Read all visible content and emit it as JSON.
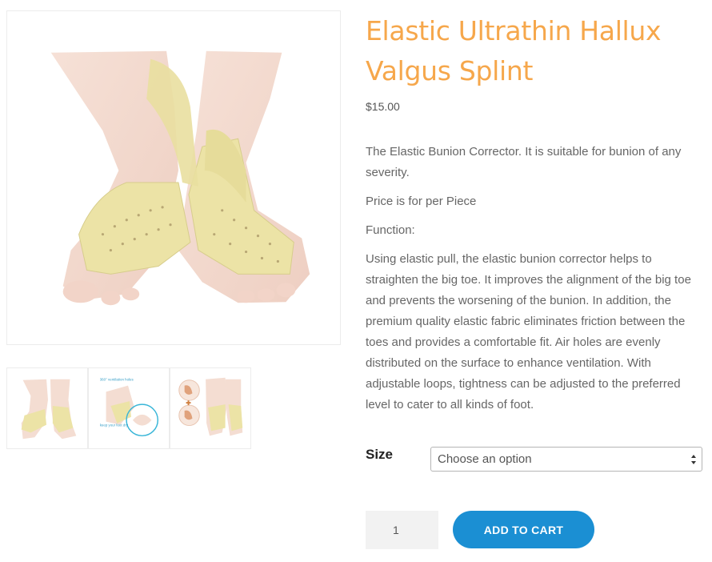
{
  "product": {
    "title": "Elastic Ultrathin Hallux Valgus Splint",
    "price": "$15.00",
    "description": [
      "The Elastic Bunion Corrector. It is suitable for bunion of any severity.",
      "Price is for per Piece",
      "Function:",
      "Using elastic pull, the elastic bunion corrector helps to straighten the big toe. It improves the alignment of the big toe and prevents the worsening of the bunion. In addition, the premium quality elastic fabric eliminates friction between the toes and provides a comfortable fit. Air holes are evenly distributed on the surface to enhance ventilation. With adjustable loops, tightness can be adjusted to the preferred level to cater to all kinds of foot."
    ]
  },
  "gallery": {
    "thumb_overlay": {
      "line1": "360° ventilation holes",
      "line2": "keep your feet dry"
    }
  },
  "variations": {
    "size_label": "Size",
    "size_selected": "Choose an option"
  },
  "cart": {
    "quantity": "1",
    "add_label": "ADD TO CART"
  },
  "colors": {
    "title": "#f6a74b",
    "button": "#1b8fd3",
    "splint": "#ece3a6"
  }
}
